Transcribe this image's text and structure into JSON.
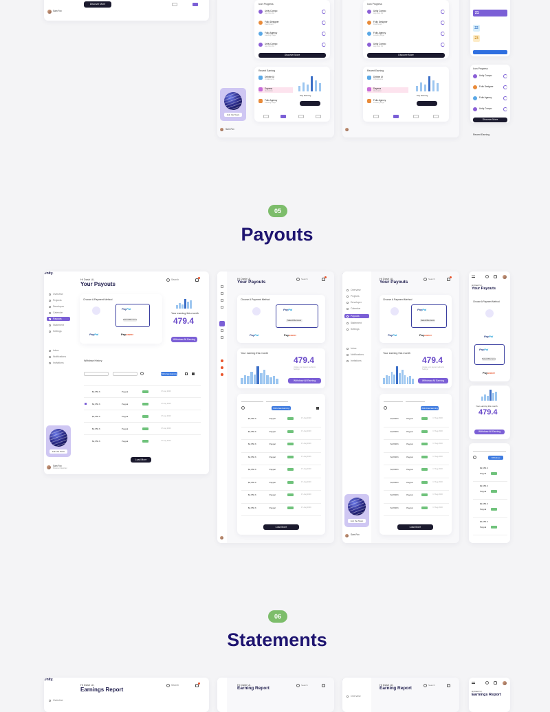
{
  "sections": [
    {
      "number": "05",
      "title": "Payouts"
    },
    {
      "number": "06",
      "title": "Statements"
    }
  ],
  "brand": "Unity.",
  "greeting": "Hi Dash UI,",
  "payouts": {
    "title": "Your Payouts",
    "search_placeholder": "Search",
    "choose_payment": "Choose A Payment Method",
    "paypal": "Pay",
    "paypal_accent": "Pal",
    "payoneer": "Pay",
    "payoneer_accent": "oneer",
    "select_label": "Select/Remove",
    "earning_label": "Your earning this month",
    "earning_value": "479.4",
    "earning_sub": "Update your payout method in Settings",
    "withdraw_btn": "Withdraw All Earning",
    "history_title": "Withdraw History",
    "filter_btn": "Withdraw Earning",
    "load_more": "Load More",
    "rows": [
      {
        "amount": "$2,656.6",
        "method": "Paypal",
        "date": "17 Aug 2020",
        "status": "Completed"
      },
      {
        "amount": "$2,656.6",
        "method": "Paypal",
        "date": "17 Aug 2020",
        "status": "Completed"
      },
      {
        "amount": "$2,656.6",
        "method": "Paypal",
        "date": "17 Aug 2020",
        "status": "Completed"
      },
      {
        "amount": "$2,656.6",
        "method": "Paypal",
        "date": "17 Aug 2020",
        "status": "Completed"
      },
      {
        "amount": "$2,656.6",
        "method": "Paypal",
        "date": "17 Aug 2020",
        "status": "Completed"
      },
      {
        "amount": "$2,656.6",
        "method": "Paypal",
        "date": "17 Aug 2020",
        "status": "Completed"
      },
      {
        "amount": "$2,656.6",
        "method": "Paypal",
        "date": "17 Aug 2020",
        "status": "Completed"
      },
      {
        "amount": "$2,656.6",
        "method": "Paypal",
        "date": "17 Aug 2020",
        "status": "Completed"
      }
    ]
  },
  "statements": {
    "title": "Earnings Report",
    "title_alt": "Earning Report",
    "search_placeholder": "Search"
  },
  "nav": [
    "Overview",
    "Projects",
    "Developer",
    "Calendar",
    "Payouts",
    "Statement",
    "Settings"
  ],
  "nav_extra": [
    "Inbox",
    "Notifications",
    "Invitations"
  ],
  "promo_btn": "Join the Team",
  "user_name": "Sam Fox",
  "user_sub": "Premium Member",
  "discover_btn": "Discover More",
  "icon_progress": "Icon Progress",
  "recent_earning": "Recent Earning",
  "progress_items": [
    {
      "title": "Unity Compo",
      "sub": "App Icon Kit"
    },
    {
      "title": "Folio Designer",
      "sub": "Dashboard"
    },
    {
      "title": "Folio Agency",
      "sub": "Landing Page"
    },
    {
      "title": "Unity Compo",
      "sub": "App Icon Kit"
    }
  ],
  "earning_items": [
    {
      "title": "Dribble UI",
      "sub": "Ui Elements",
      "tag": "$49"
    },
    {
      "title": "Dapena",
      "sub": "Illustration",
      "tag": "$49"
    },
    {
      "title": "Folio Agency",
      "sub": "Landing Page",
      "tag": "$49"
    }
  ],
  "pay_earning": "Pay Earning",
  "dates": [
    "21",
    "22",
    "23"
  ],
  "colors": {
    "accent": "#7b5fd6",
    "navy": "#1e1470",
    "badge": "#7dbd6b",
    "bar": "#9cc6f0",
    "bar_highlight": "#3c6fc7"
  },
  "bar_levels": [
    0.35,
    0.5,
    0.45,
    0.7,
    0.55,
    1.0,
    0.6,
    0.8,
    0.5,
    0.4,
    0.45,
    0.3
  ]
}
